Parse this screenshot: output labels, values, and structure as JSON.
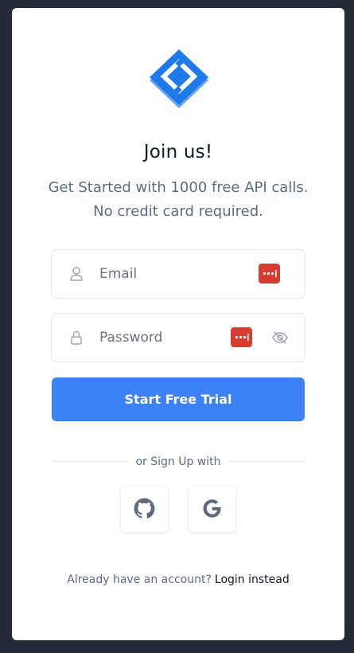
{
  "app": {
    "title": "Join us!",
    "subtitle_line1": "Get Started with 1000 free API calls.",
    "subtitle_line2": "No credit card required.",
    "brand_color": "#3a82f6"
  },
  "form": {
    "email": {
      "placeholder": "Email",
      "value": "",
      "icon": "user-icon"
    },
    "password": {
      "placeholder": "Password",
      "value": "",
      "icon": "lock-icon",
      "toggle_icon": "eye-slash-icon"
    },
    "submit_label": "Start Free Trial"
  },
  "social": {
    "divider_text": "or Sign Up with",
    "providers": [
      "github-icon",
      "google-icon"
    ]
  },
  "footer": {
    "prompt": "Already have an account?",
    "link": "Login instead"
  }
}
